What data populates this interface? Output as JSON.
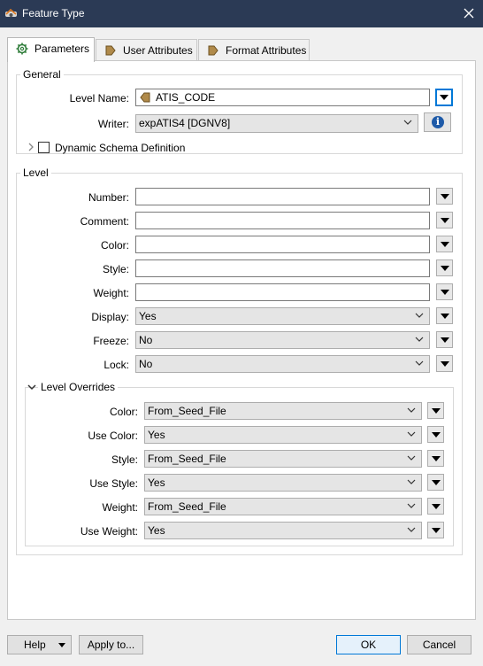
{
  "window": {
    "title": "Feature Type",
    "close_icon": "close-icon"
  },
  "tabs": [
    {
      "label": "Parameters",
      "icon": "gear-icon"
    },
    {
      "label": "User Attributes",
      "icon": "feature-arrow-icon"
    },
    {
      "label": "Format Attributes",
      "icon": "feature-arrow-icon"
    }
  ],
  "general": {
    "title": "General",
    "level_name": {
      "label": "Level Name:",
      "value": "ATIS_CODE"
    },
    "writer": {
      "label": "Writer:",
      "value": "expATIS4 [DGNV8]"
    },
    "dynamic_schema": {
      "label": "Dynamic Schema Definition",
      "checked": false
    }
  },
  "level": {
    "title": "Level",
    "number": {
      "label": "Number:",
      "value": ""
    },
    "comment": {
      "label": "Comment:",
      "value": ""
    },
    "color": {
      "label": "Color:",
      "value": ""
    },
    "style": {
      "label": "Style:",
      "value": ""
    },
    "weight": {
      "label": "Weight:",
      "value": ""
    },
    "display": {
      "label": "Display:",
      "value": "Yes"
    },
    "freeze": {
      "label": "Freeze:",
      "value": "No"
    },
    "lock": {
      "label": "Lock:",
      "value": "No"
    }
  },
  "overrides": {
    "title": "Level Overrides",
    "color": {
      "label": "Color:",
      "value": "From_Seed_File"
    },
    "use_color": {
      "label": "Use Color:",
      "value": "Yes"
    },
    "style": {
      "label": "Style:",
      "value": "From_Seed_File"
    },
    "use_style": {
      "label": "Use Style:",
      "value": "Yes"
    },
    "weight": {
      "label": "Weight:",
      "value": "From_Seed_File"
    },
    "use_weight": {
      "label": "Use Weight:",
      "value": "Yes"
    }
  },
  "footer": {
    "help": "Help",
    "apply_to": "Apply to...",
    "ok": "OK",
    "cancel": "Cancel"
  },
  "colors": {
    "titlebar": "#2b3a55",
    "accent": "#0078d7",
    "info": "#1e5aa8"
  }
}
